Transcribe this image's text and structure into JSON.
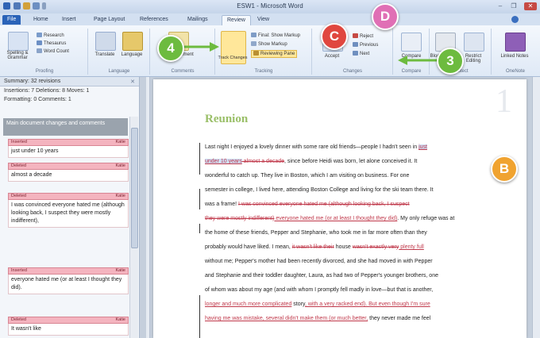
{
  "window": {
    "title": "ESW1 - Microsoft Word"
  },
  "tabs": [
    "File",
    "Home",
    "Insert",
    "Page Layout",
    "References",
    "Mailings",
    "Review",
    "View"
  ],
  "ribbon": {
    "proofing": {
      "spelling": "Spelling & Grammar",
      "research": "Research",
      "thesaurus": "Thesaurus",
      "word_count": "Word Count",
      "group": "Proofing"
    },
    "language": {
      "translate": "Translate",
      "language": "Language",
      "group": "Language"
    },
    "comments": {
      "new_comment": "New Comment",
      "group": "Comments"
    },
    "tracking": {
      "track_changes": "Track Changes",
      "final_markup": "Final: Show Markup",
      "show_markup": "Show Markup",
      "reviewing_pane": "Reviewing Pane",
      "group": "Tracking"
    },
    "changes": {
      "accept": "Accept",
      "reject": "Reject",
      "previous": "Previous",
      "next": "Next",
      "group": "Changes"
    },
    "compare": {
      "compare": "Compare",
      "group": "Compare"
    },
    "protect": {
      "block_authors": "Block Authors",
      "restrict_editing": "Restrict Editing",
      "group": "Protect"
    },
    "onenote": {
      "linked_notes": "Linked Notes",
      "group": "OneNote"
    }
  },
  "callouts": {
    "b": "B",
    "c": "C",
    "d": "D",
    "n3": "3",
    "n4": "4"
  },
  "pane": {
    "title": "Summary: 32 revisions",
    "line1": "Insertions: 7  Deletions: 8  Moves: 1",
    "line2": "Formatting: 0  Comments: 1",
    "main_header": "Main document changes and comments",
    "items": [
      {
        "type": "Inserted",
        "author": "Katie",
        "text": "just under 10 years"
      },
      {
        "type": "Deleted",
        "author": "Katie",
        "text": "almost a decade"
      },
      {
        "type": "Deleted",
        "author": "Katie",
        "text": "I was convinced everyone hated me (although looking back, I suspect they were mostly indifferent),"
      },
      {
        "type": "Inserted",
        "author": "Katie",
        "text": "everyone hated me (or at least I thought they did)."
      },
      {
        "type": "Deleted",
        "author": "Katie",
        "text": "It wasn't like"
      }
    ]
  },
  "doc": {
    "page_number": "1",
    "heading": "Reunion",
    "l1a": "Last night I enjoyed a lovely dinner with some rare old friends—people I hadn't seen in ",
    "l1b": "just",
    "l2a": "under 10 years",
    "l2b": " almost a decade",
    "l2c": ", since before Heidi was born, let alone conceived it. It",
    "l3": "wonderful to catch up. They live in Boston, which I am visiting on business. For one",
    "l4": "semester in college, I lived here, attending Boston College and living for the ski team there. It",
    "l5a": "was a frame! ",
    "l5b": "I was convinced everyone hated me (although looking back, I suspect",
    "l6a": "they were mostly indifferent)",
    "l6b": " everyone hated me (or at least I thought they did)",
    "l6c": ". My only refuge was at",
    "l7": "the home of these friends, Pepper and Stephanie, who took me in far more often than they",
    "l8a": "probably would have liked. I mean, ",
    "l8b": "it wasn't like their",
    "l8c": " house ",
    "l8d": "wasn't exactly very",
    "l8e": " plenty full",
    "l9": "without me; Pepper's mother had been recently divorced, and she had moved in with Pepper",
    "l10": "and Stephanie and their toddler daughter, Laura, as had two of Pepper's younger brothers, one",
    "l11": "of whom was about my age (and with whom I promptly fell madly in love—but that is another,",
    "l12a": "longer and much more complicated",
    "l12b": " story",
    "l12c": ", with a very racked end",
    "l12d": "). But even though I'm sure",
    "l13a": "having me was mistake, several didn't make them (or much better,",
    "l13b": " they never made me feel"
  }
}
